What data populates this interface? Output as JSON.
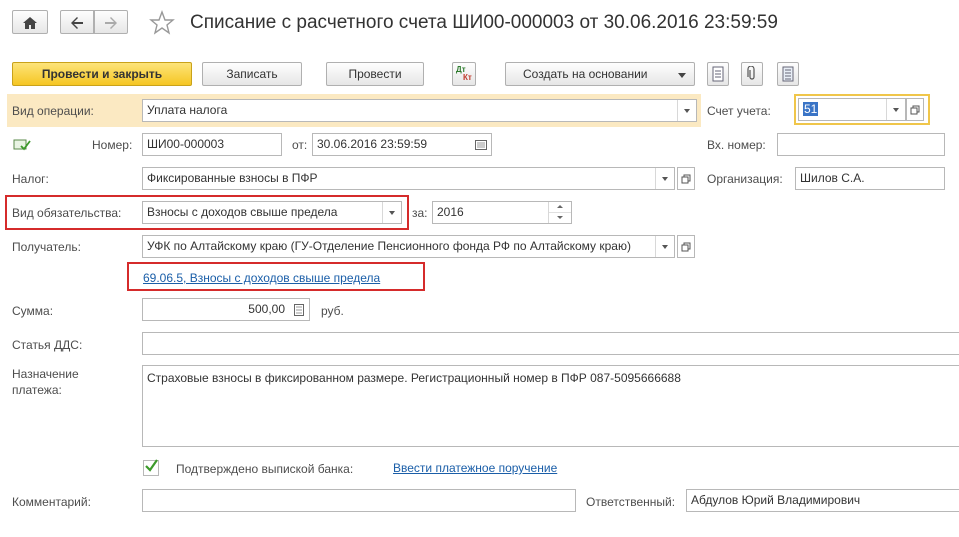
{
  "title": "Списание с расчетного счета ШИ00-000003 от 30.06.2016 23:59:59",
  "toolbar": {
    "post_close": "Провести и закрыть",
    "save": "Записать",
    "post": "Провести",
    "dtkt_top": "Дт",
    "dtkt_bottom": "Кт",
    "create_based": "Создать на основании"
  },
  "form": {
    "operation_type_label": "Вид операции:",
    "operation_type_value": "Уплата налога",
    "account_label": "Счет учета:",
    "account_value": "51",
    "number_label": "Номер:",
    "number_value": "ШИ00-000003",
    "date_label": "от:",
    "date_value": "30.06.2016 23:59:59",
    "in_number_label": "Вх. номер:",
    "in_number_value": "",
    "tax_label": "Налог:",
    "tax_value": "Фиксированные взносы в ПФР",
    "org_label": "Организация:",
    "org_value": "Шилов С.А.",
    "obligation_label": "Вид обязательства:",
    "obligation_value": "Взносы с доходов свыше предела",
    "period_label": "за:",
    "period_value": "2016",
    "recipient_label": "Получатель:",
    "recipient_value": "УФК по Алтайскому краю (ГУ-Отделение Пенсионного фонда РФ по Алтайскому краю)",
    "account_link": "69.06.5, Взносы с доходов свыше предела",
    "sum_label": "Сумма:",
    "sum_value": "500,00",
    "currency": "руб.",
    "dds_label": "Статья ДДС:",
    "dds_value": "",
    "purpose_label": "Назначение платежа:",
    "purpose_value": "Страховые взносы в фиксированном размере. Регистрационный номер в ПФР 087-5095666688",
    "confirmed_label": "Подтверждено выпиской банка:",
    "confirmed": true,
    "payment_order_link": "Ввести платежное поручение",
    "comment_label": "Комментарий:",
    "comment_value": "",
    "responsible_label": "Ответственный:",
    "responsible_value": "Абдулов Юрий Владимирович"
  },
  "colors": {
    "accent_yellow": "#f5c623",
    "highlight_row": "#fbe9c2",
    "red_annotation": "#d52b2b",
    "link": "#1a5ea8",
    "selection": "#3a74c6"
  }
}
